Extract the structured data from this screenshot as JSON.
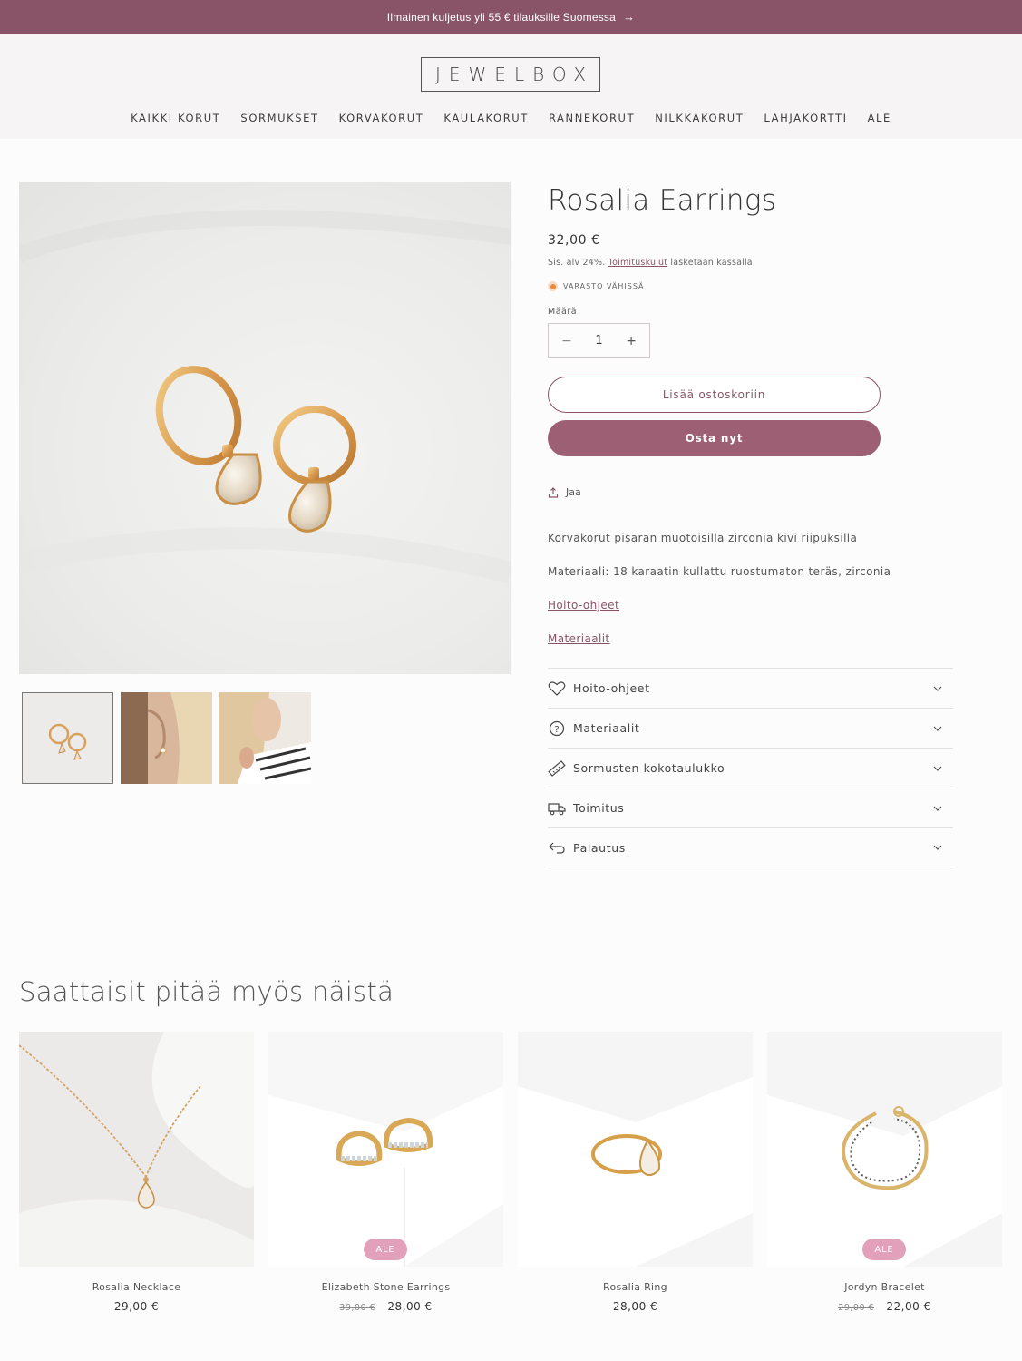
{
  "announcement": {
    "text": "Ilmainen kuljetus yli 55 € tilauksille Suomessa",
    "arrow": "→"
  },
  "brand": {
    "logo_text": "JEWELBOX"
  },
  "nav": [
    "KAIKKI KORUT",
    "SORMUKSET",
    "KORVAKORUT",
    "KAULAKORUT",
    "RANNEKORUT",
    "NILKKAKORUT",
    "LAHJAKORTTI",
    "ALE"
  ],
  "product": {
    "title": "Rosalia Earrings",
    "price": "32,00 €",
    "tax_prefix": "Sis. alv 24%.",
    "tax_link": "Toimituskulut",
    "tax_suffix": "lasketaan kassalla.",
    "stock": "VARASTO VÄHISSÄ",
    "qty_label": "Määrä",
    "qty_value": "1",
    "qty_minus": "−",
    "qty_plus": "+",
    "add_to_cart": "Lisää ostoskoriin",
    "buy_now": "Osta nyt",
    "share": "Jaa",
    "description": "Korvakorut pisaran muotoisilla zirconia kivi riipuksilla",
    "material": "Materiaali: 18 karaatin kullattu ruostumaton teräs, zirconia",
    "link_care": "Hoito-ohjeet",
    "link_materials": "Materiaalit"
  },
  "accordion": [
    {
      "label": "Hoito-ohjeet",
      "icon": "heart-icon"
    },
    {
      "label": "Materiaalit",
      "icon": "question-icon"
    },
    {
      "label": "Sormusten kokotaulukko",
      "icon": "ruler-icon"
    },
    {
      "label": "Toimitus",
      "icon": "truck-icon"
    },
    {
      "label": "Palautus",
      "icon": "return-icon"
    }
  ],
  "recommendations": {
    "title": "Saattaisit pitää myös näistä",
    "badge": "ALE",
    "items": [
      {
        "name": "Rosalia Necklace",
        "price": "29,00 €",
        "old_price": "",
        "sale": false
      },
      {
        "name": "Elizabeth Stone Earrings",
        "price": "28,00 €",
        "old_price": "39,00 €",
        "sale": true
      },
      {
        "name": "Rosalia Ring",
        "price": "28,00 €",
        "old_price": "",
        "sale": false
      },
      {
        "name": "Jordyn Bracelet",
        "price": "22,00 €",
        "old_price": "29,00 €",
        "sale": true
      }
    ]
  },
  "colors": {
    "accent": "#8a5468",
    "button": "#9c5f73",
    "badge": "#e3a0ba",
    "stock_dot": "#ea8a3e"
  }
}
